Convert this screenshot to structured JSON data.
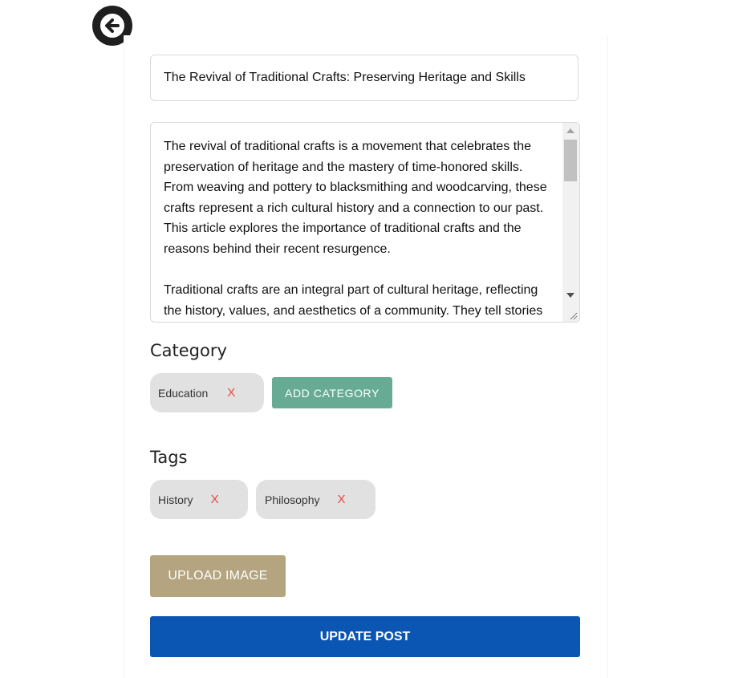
{
  "back_icon": "arrow-left-icon",
  "post": {
    "title": "The Revival of Traditional Crafts: Preserving Heritage and Skills",
    "body_paragraphs": [
      "The revival of traditional crafts is a movement that celebrates the preservation of heritage and the mastery of time-honored skills. From weaving and pottery to blacksmithing and woodcarving, these crafts represent a rich cultural history and a connection to our past. This article explores the importance of traditional crafts and the reasons behind their recent resurgence.",
      "Traditional crafts are an integral part of cultural heritage, reflecting the history, values, and aesthetics of a community. They tell stories"
    ]
  },
  "category": {
    "heading": "Category",
    "items": [
      {
        "label": "Education",
        "remove": "X"
      }
    ],
    "add_label": "ADD CATEGORY"
  },
  "tags": {
    "heading": "Tags",
    "items": [
      {
        "label": "History",
        "remove": "X"
      },
      {
        "label": "Philosophy",
        "remove": "X"
      }
    ]
  },
  "upload_label": "UPLOAD IMAGE",
  "update_label": "UPDATE POST",
  "colors": {
    "add_category": "#67ab94",
    "upload": "#b4a47f",
    "update": "#0b55b3",
    "remove_x": "#e8463f",
    "chip": "#e1e1e1"
  }
}
